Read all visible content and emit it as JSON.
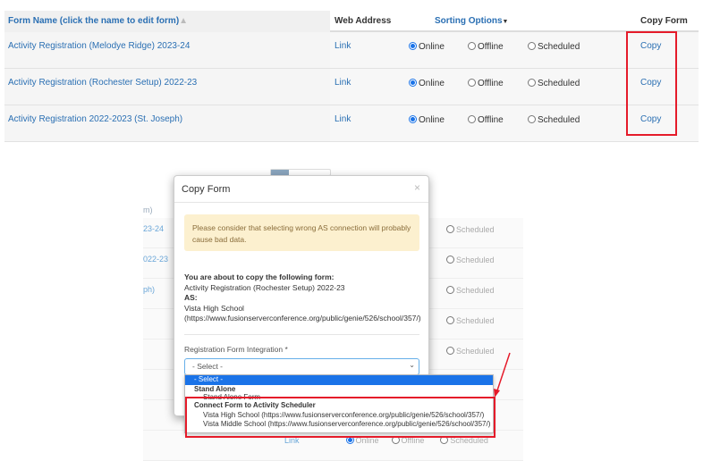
{
  "table": {
    "headers": {
      "form_name": "Form Name (click the name to edit form)",
      "web_address": "Web Address",
      "sorting": "Sorting Options",
      "copy": "Copy Form"
    },
    "rows": [
      {
        "name": "Activity Registration (Melodye Ridge) 2023-24",
        "link": "Link",
        "online": "Online",
        "offline": "Offline",
        "scheduled": "Scheduled",
        "copy": "Copy",
        "selected": "Online"
      },
      {
        "name": "Activity Registration (Rochester Setup) 2022-23",
        "link": "Link",
        "online": "Online",
        "offline": "Offline",
        "scheduled": "Scheduled",
        "copy": "Copy",
        "selected": "Online"
      },
      {
        "name": "Activity Registration 2022-2023 (St. Joseph)",
        "link": "Link",
        "online": "Online",
        "offline": "Offline",
        "scheduled": "Scheduled",
        "copy": "Copy",
        "selected": "Online"
      }
    ]
  },
  "background": {
    "header_fragment": "m)",
    "row_fragments": [
      "23-24",
      "022-23",
      "ph)"
    ],
    "scheduled": "Scheduled",
    "link": "Link",
    "online": "Online",
    "offline": "Offline"
  },
  "modal": {
    "title": "Copy Form",
    "close": "×",
    "warning": "Please consider that selecting wrong AS connection will probably cause bad data.",
    "intro": "You are about to copy the following form:",
    "form_name": "Activity Registration (Rochester Setup) 2022-23",
    "as_label": "AS:",
    "as_value": "Vista High School",
    "as_url": "(https://www.fusionserverconference.org/public/genie/526/school/357/)",
    "field_label": "Registration Form Integration *",
    "select_value": "- Select -"
  },
  "dropdown": {
    "options": [
      {
        "label": "- Select -",
        "type": "option",
        "highlighted": true
      },
      {
        "label": "Stand Alone",
        "type": "group"
      },
      {
        "label": "Stand Alone Form",
        "type": "option"
      },
      {
        "label": "Connect Form to Activity Scheduler",
        "type": "group"
      },
      {
        "label": "Vista High School (https://www.fusionserverconference.org/public/genie/526/school/357/)",
        "type": "option"
      },
      {
        "label": "Vista Middle School (https://www.fusionserverconference.org/public/genie/526/school/357/)",
        "type": "option"
      }
    ]
  },
  "colors": {
    "link": "#2a6fb3",
    "highlight": "#e51b2a",
    "selected_option": "#1a73e8"
  }
}
